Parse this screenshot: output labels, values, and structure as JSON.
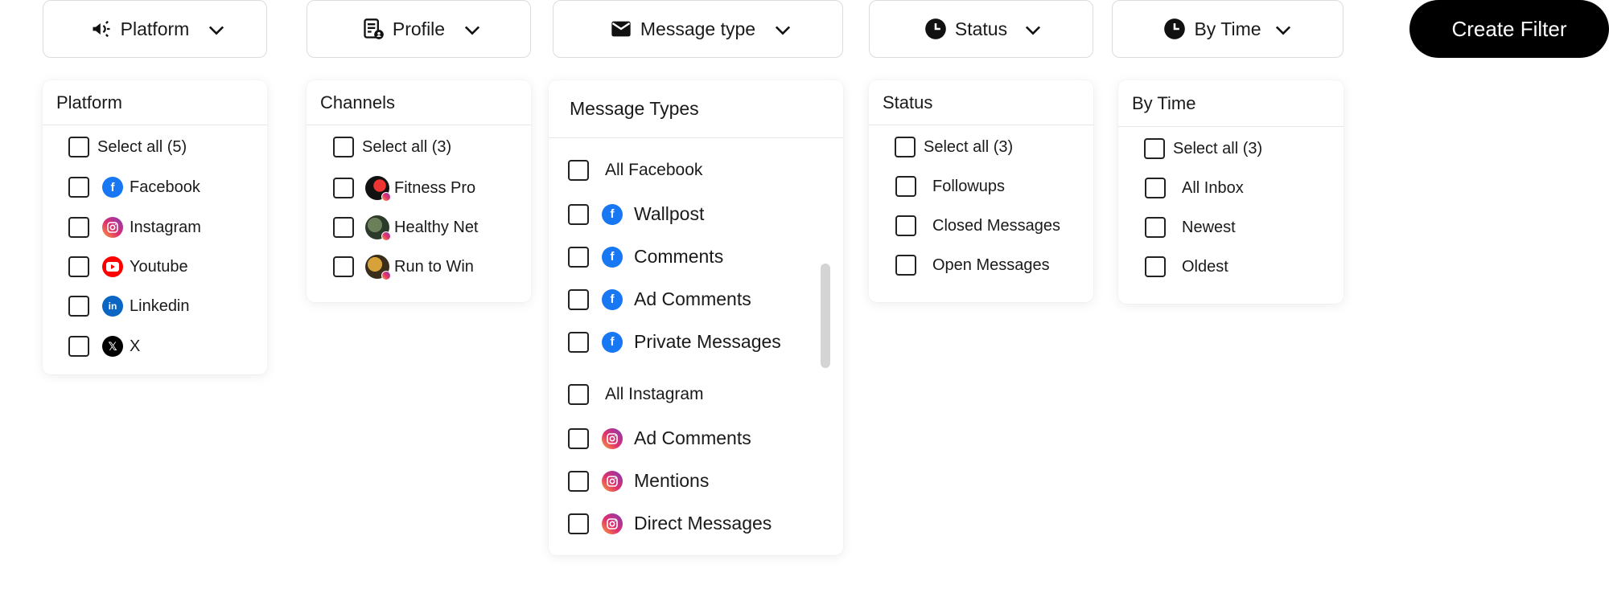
{
  "toolbar": {
    "platform_label": "Platform",
    "profile_label": "Profile",
    "message_type_label": "Message type",
    "status_label": "Status",
    "by_time_label": "By Time",
    "create_filter_label": "Create Filter"
  },
  "icons": {
    "platform": "megaphone-icon",
    "profile": "profile-list-icon",
    "message_type": "envelope-icon",
    "status": "clock-icon",
    "by_time": "clock-icon",
    "chevron": "chevron-down-icon"
  },
  "colors": {
    "facebook": "#1877f2",
    "youtube": "#ff0000",
    "linkedin": "#0a66c2",
    "x": "#000000",
    "create_button": "#000000"
  },
  "platform_panel": {
    "title": "Platform",
    "select_all": "Select all (5)",
    "items": [
      {
        "label": "Facebook",
        "icon": "facebook-icon"
      },
      {
        "label": "Instagram",
        "icon": "instagram-icon"
      },
      {
        "label": "Youtube",
        "icon": "youtube-icon"
      },
      {
        "label": "Linkedin",
        "icon": "linkedin-icon"
      },
      {
        "label": "X",
        "icon": "x-icon"
      }
    ]
  },
  "channels_panel": {
    "title": "Channels",
    "select_all": "Select all (3)",
    "items": [
      {
        "label": "Fitness Pro"
      },
      {
        "label": "Healthy Net"
      },
      {
        "label": "Run to Win"
      }
    ]
  },
  "message_types_panel": {
    "title": "Message Types",
    "facebook_group": "All Facebook",
    "facebook_items": [
      "Wallpost",
      "Comments",
      "Ad Comments",
      "Private Messages"
    ],
    "instagram_group": "All Instagram",
    "instagram_items": [
      "Ad Comments",
      "Mentions",
      "Direct Messages"
    ]
  },
  "status_panel": {
    "title": "Status",
    "select_all": "Select all (3)",
    "items": [
      "Followups",
      "Closed Messages",
      "Open Messages"
    ]
  },
  "by_time_panel": {
    "title": "By Time",
    "select_all": "Select all (3)",
    "items": [
      "All Inbox",
      "Newest",
      "Oldest"
    ]
  }
}
